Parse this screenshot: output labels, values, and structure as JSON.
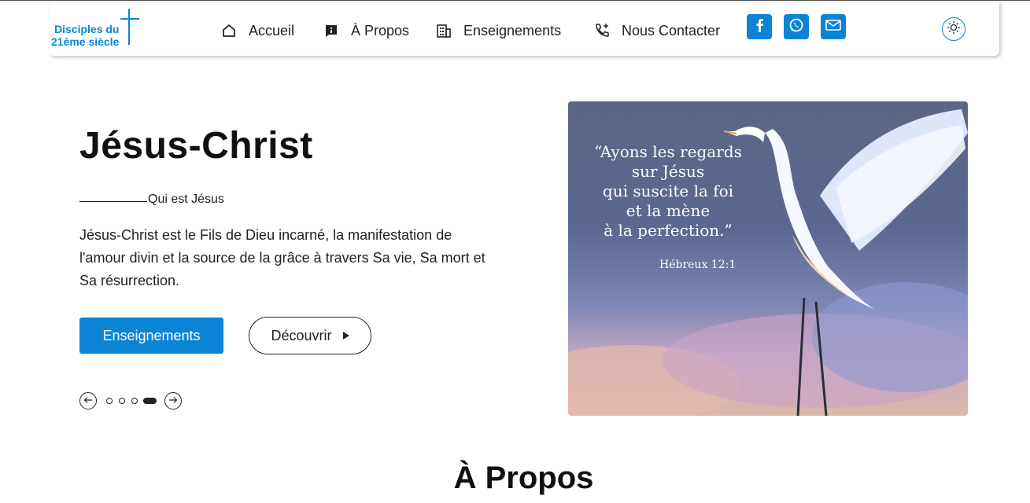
{
  "header": {
    "logo": {
      "line1": "Disciples du",
      "line2": "21ème siècle"
    },
    "nav": [
      {
        "label": "Accueil",
        "icon": "home-icon"
      },
      {
        "label": "À Propos",
        "icon": "info-icon"
      },
      {
        "label": "Enseignements",
        "icon": "building-icon"
      },
      {
        "label": "Nous Contacter",
        "icon": "phone-plus-icon"
      }
    ],
    "social": [
      {
        "name": "facebook",
        "icon": "facebook-icon"
      },
      {
        "name": "whatsapp",
        "icon": "whatsapp-icon"
      },
      {
        "name": "email",
        "icon": "mail-icon"
      }
    ],
    "theme_toggle_icon": "sun-icon"
  },
  "hero": {
    "title": "Jésus-Christ",
    "subtitle": "Qui est Jésus",
    "description": "Jésus-Christ est le Fils de Dieu incarné, la manifestation de l'amour divin et la source de la grâce à travers Sa vie, Sa mort et Sa résurrection.",
    "primary_button": "Enseignements",
    "secondary_button": "Découvrir",
    "carousel": {
      "slides": 4,
      "active_index": 4
    },
    "image": {
      "verse": "“Ayons les regards\nsur Jésus\nqui suscite la foi\net la mène\nà la perfection.”",
      "reference": "Hébreux 12:1"
    }
  },
  "section": {
    "title": "À Propos"
  },
  "colors": {
    "accent": "#0b84d6",
    "text": "#111111"
  }
}
